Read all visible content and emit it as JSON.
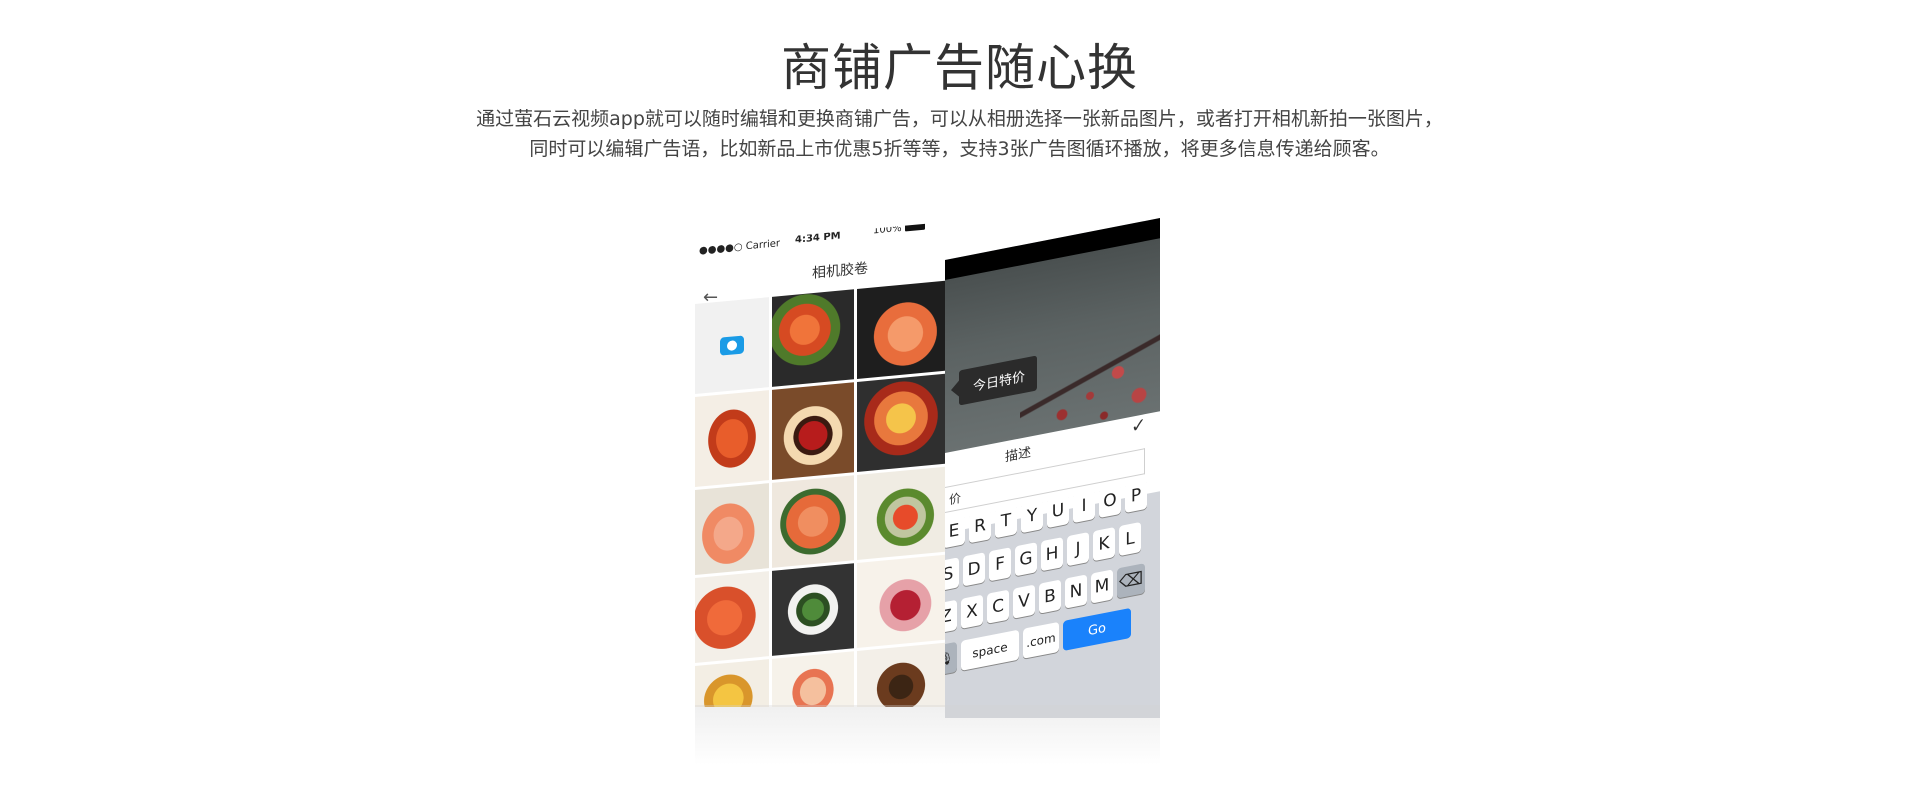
{
  "header": {
    "title": "商铺广告随心换",
    "desc_line1": "通过萤石云视频app就可以随时编辑和更换商铺广告，可以从相册选择一张新品图片，或者打开相机新拍一张图片，",
    "desc_line2": "同时可以编辑广告语，比如新品上市优惠5折等等，支持3张广告图循环播放，将更多信息传递给顾客。"
  },
  "left_phone": {
    "status": {
      "carrier": "●●●●○ Carrier",
      "time": "4:34 PM",
      "battery": "100%"
    },
    "nav_title": "相机胶卷",
    "back_icon": "←"
  },
  "right_phone": {
    "tag_text": "今日特价",
    "editor_label": "描述",
    "editor_check": "✓",
    "field_value": "价",
    "keyboard": {
      "row1": [
        "E",
        "R",
        "T",
        "Y",
        "U",
        "I",
        "O",
        "P"
      ],
      "row2": [
        "S",
        "D",
        "F",
        "G",
        "H",
        "J",
        "K",
        "L"
      ],
      "row3": [
        "Z",
        "X",
        "C",
        "V",
        "B",
        "N",
        "M"
      ],
      "space_label": "space",
      "dotcom_label": ".com",
      "go_label": "Go",
      "mic_icon": "🎙",
      "delete_icon": "⌫"
    }
  },
  "colors": {
    "title": "#333333",
    "go_button": "#1a82fb",
    "camera_icon": "#1a9be6"
  }
}
